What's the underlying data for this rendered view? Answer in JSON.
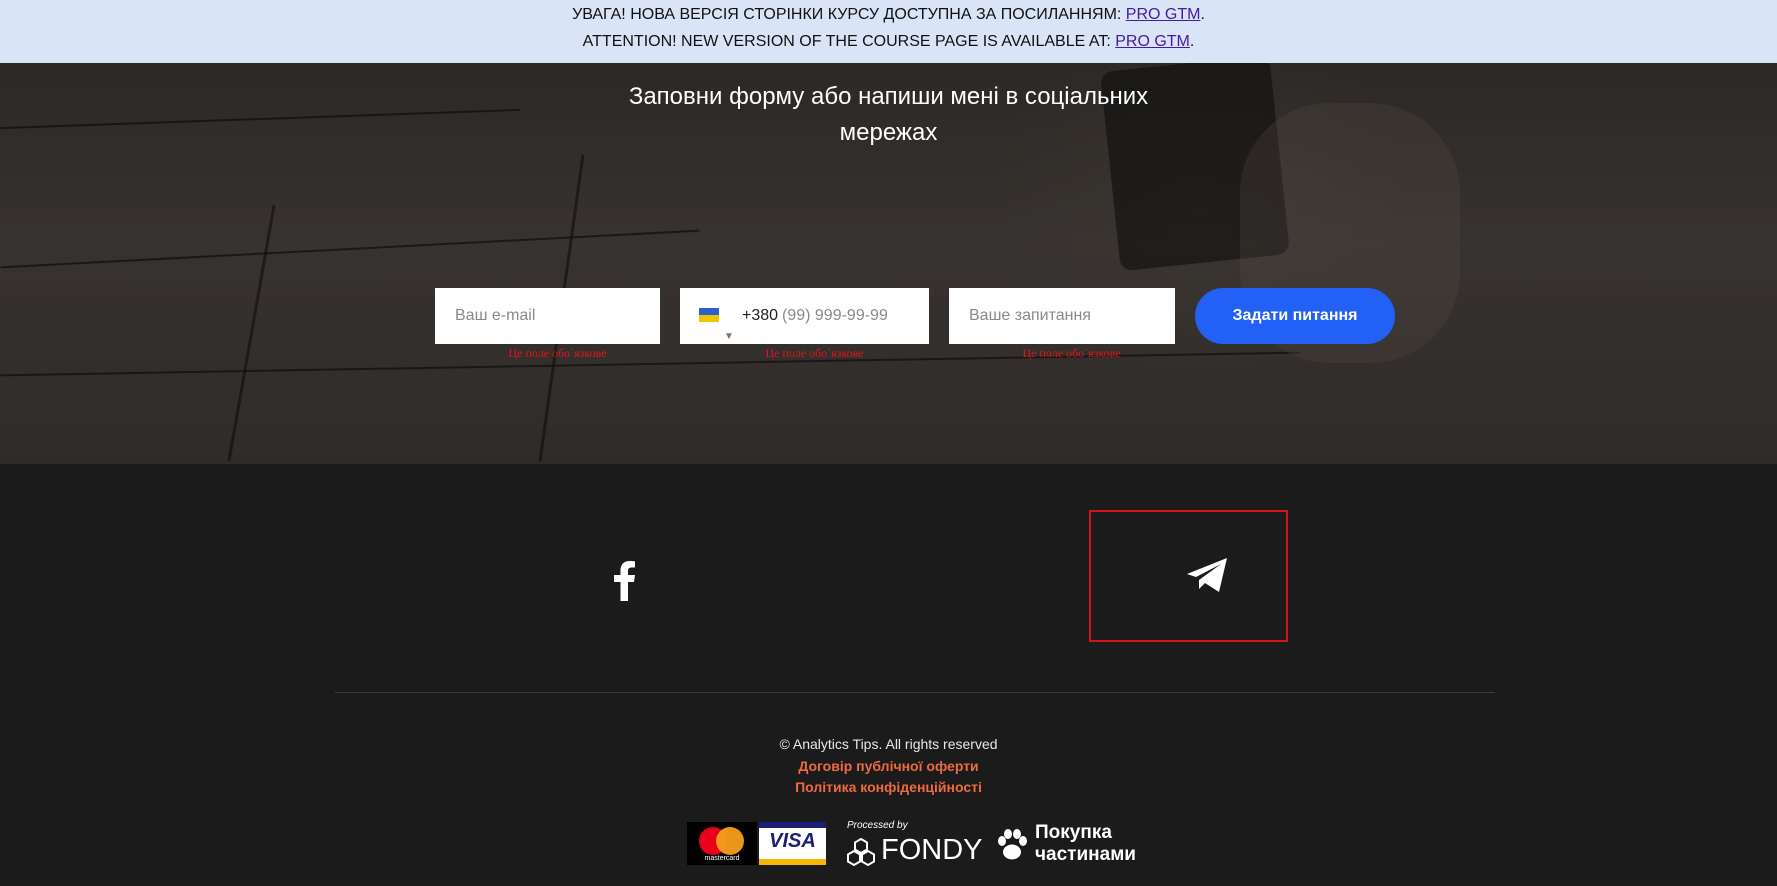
{
  "banner": {
    "line1_text": "УВАГА! НОВА ВЕРСІЯ СТОРІНКИ КУРСУ ДОСТУПНА ЗА ПОСИЛАННЯМ: ",
    "line1_link": "PRO GTM",
    "line2_text": "ATTENTION! NEW VERSION OF THE COURSE PAGE IS AVAILABLE AT: ",
    "line2_link": "PRO GTM",
    "period": "."
  },
  "hero": {
    "title_line1": "Заповни форму або напиши мені в соціальних",
    "title_line2": "мережах"
  },
  "form": {
    "email_placeholder": "Ваш e-mail",
    "phone_code": "+380",
    "phone_placeholder": "(99) 999-99-99",
    "question_placeholder": "Ваше запитання",
    "required_error": "Це поле обо`язкове",
    "submit_label": "Задати питання"
  },
  "social": {
    "icons": [
      "facebook-icon",
      "telegram-icon"
    ]
  },
  "footer": {
    "copyright": "© Analytics Tips. All rights reserved",
    "offer_link": "Договір публічної оферти",
    "privacy_link": "Політика конфіденційності",
    "payments": {
      "mastercard_label": "mastercard",
      "visa_label": "VISA",
      "fondy_caption": "Processed by",
      "fondy_label": "FONDY",
      "parts_line1": "Покупка",
      "parts_line2": "частинами"
    }
  },
  "colors": {
    "banner_bg": "#d9e4f7",
    "accent_button": "#2360f5",
    "footer_link": "#ee6a3f",
    "error": "#e0141e",
    "highlight_box": "#d0141c"
  }
}
